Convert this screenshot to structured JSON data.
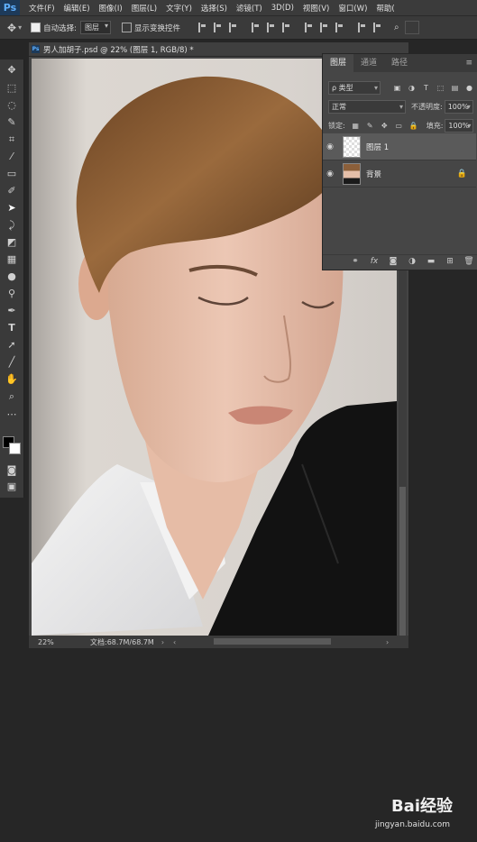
{
  "app": {
    "logo": "Ps"
  },
  "menu": [
    "文件(F)",
    "编辑(E)",
    "图像(I)",
    "图层(L)",
    "文字(Y)",
    "选择(S)",
    "滤镜(T)",
    "3D(D)",
    "视图(V)",
    "窗口(W)",
    "帮助("
  ],
  "options": {
    "auto_select_label": "自动选择:",
    "auto_select_value": "图层",
    "show_transform_label": "显示变换控件"
  },
  "document": {
    "tab_title": "男人加胡子.psd @ 22% (图层 1, RGB/8) *",
    "zoom": "22%",
    "doc_size": "文档:68.7M/68.7M"
  },
  "layers_panel": {
    "tabs": [
      "图层",
      "通道",
      "路径"
    ],
    "filter_kind": "ρ 类型",
    "blend_mode": "正常",
    "opacity_label": "不透明度:",
    "opacity_value": "100%",
    "lock_label": "锁定:",
    "fill_label": "填充:",
    "fill_value": "100%",
    "layers": [
      {
        "name": "图层 1"
      },
      {
        "name": "背景"
      }
    ],
    "bottom_fx": "fx"
  },
  "watermark": {
    "brand": "Bai经验",
    "url": "jingyan.baidu.com"
  },
  "colors": {
    "ui_dark": "#262626",
    "panel": "#464646",
    "selected_layer": "#5a5a5a",
    "accent_blue": "#5fb0ff"
  }
}
